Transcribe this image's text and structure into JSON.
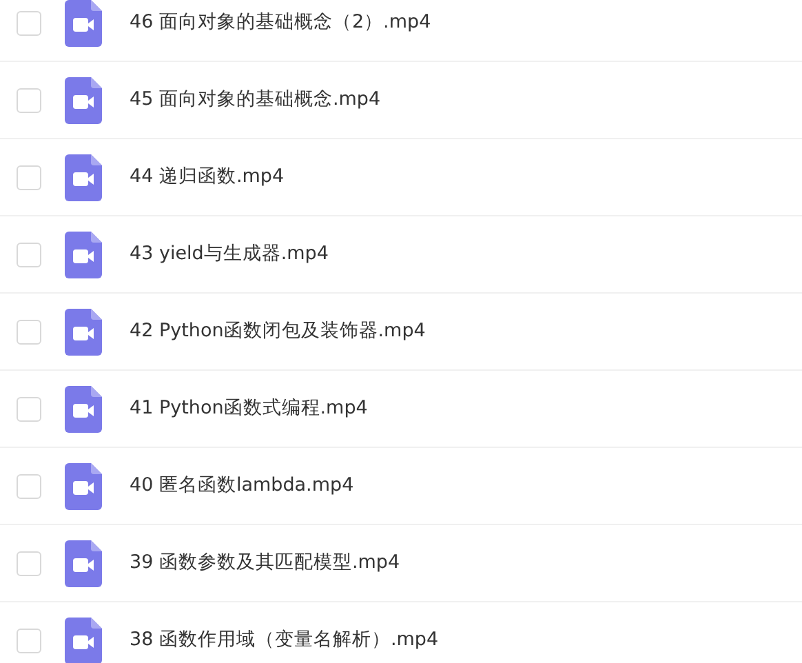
{
  "files": [
    {
      "name": "46 面向对象的基础概念（2）.mp4",
      "checked": false
    },
    {
      "name": "45 面向对象的基础概念.mp4",
      "checked": false
    },
    {
      "name": "44 递归函数.mp4",
      "checked": false
    },
    {
      "name": "43 yield与生成器.mp4",
      "checked": false
    },
    {
      "name": "42 Python函数闭包及装饰器.mp4",
      "checked": false
    },
    {
      "name": "41 Python函数式编程.mp4",
      "checked": false
    },
    {
      "name": "40 匿名函数lambda.mp4",
      "checked": false
    },
    {
      "name": "39 函数参数及其匹配模型.mp4",
      "checked": false
    },
    {
      "name": "38 函数作用域（变量名解析）.mp4",
      "checked": false
    }
  ]
}
